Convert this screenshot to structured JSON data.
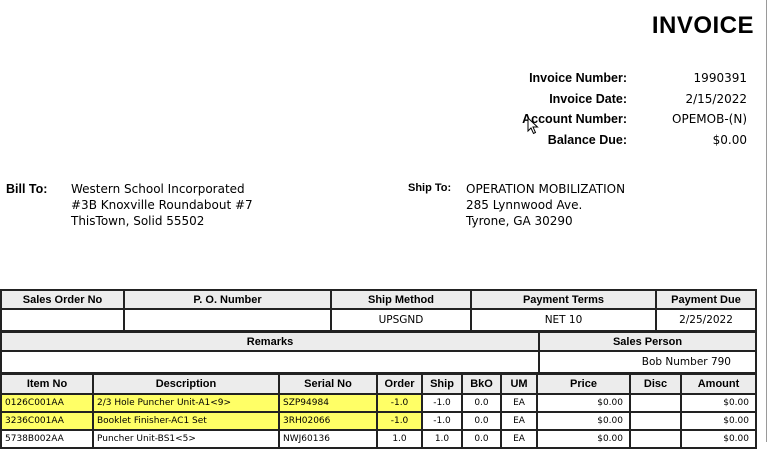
{
  "invoice": {
    "title": "INVOICE",
    "meta": [
      {
        "label": "Invoice Number:",
        "value": "1990391"
      },
      {
        "label": "Invoice Date:",
        "value": "2/15/2022"
      },
      {
        "label": "Account Number:",
        "value": "OPEMOB-(N)"
      },
      {
        "label": "Balance Due:",
        "value": "$0.00"
      }
    ]
  },
  "bill_to": {
    "label": "Bill To:",
    "lines": [
      "Western School Incorporated",
      "#3B Knoxville Roundabout #7",
      "ThisTown, Solid  55502"
    ]
  },
  "ship_to": {
    "label": "Ship To:",
    "lines": [
      "OPERATION MOBILIZATION",
      "285 Lynnwood Ave.",
      "Tyrone, GA  30290"
    ]
  },
  "order": {
    "headers": [
      "Sales Order No",
      "P. O. Number",
      "Ship Method",
      "Payment Terms",
      "Payment Due"
    ],
    "values": [
      "",
      "",
      "UPSGND",
      "NET 10",
      "2/25/2022"
    ]
  },
  "remarks": {
    "headers": [
      "Remarks",
      "Sales Person"
    ],
    "values": [
      "",
      "Bob Number 790"
    ]
  },
  "items": {
    "headers": [
      "Item No",
      "Description",
      "Serial No",
      "Order",
      "Ship",
      "BkO",
      "UM",
      "Price",
      "Disc",
      "Amount"
    ],
    "rows": [
      [
        "0126C001AA",
        "2/3 Hole Puncher Unit-A1<9>",
        "SZP94984",
        "-1.0",
        "-1.0",
        "0.0",
        "EA",
        "$0.00",
        "",
        "$0.00"
      ],
      [
        "3236C001AA",
        "Booklet Finisher-AC1 Set",
        "3RH02066",
        "-1.0",
        "-1.0",
        "0.0",
        "EA",
        "$0.00",
        "",
        "$0.00"
      ],
      [
        "5738B002AA",
        "Puncher Unit-BS1<5>",
        "NWJ60136",
        "1.0",
        "1.0",
        "0.0",
        "EA",
        "$0.00",
        "",
        "$0.00"
      ]
    ],
    "highlight_color": "#ffff66"
  }
}
